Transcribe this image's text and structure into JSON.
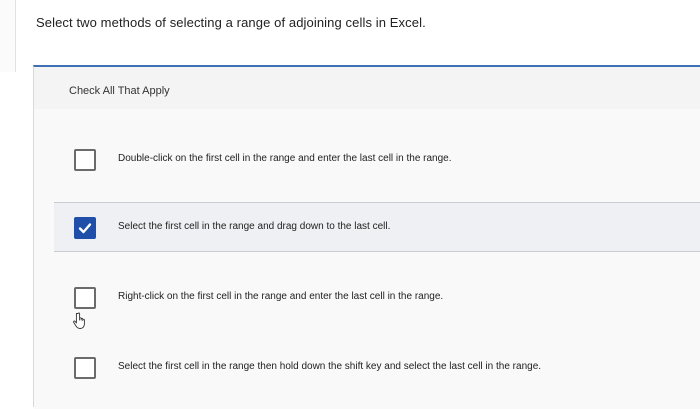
{
  "question": {
    "text": "Select two methods of selecting a range of adjoining cells in Excel."
  },
  "panel": {
    "instruction": "Check All That Apply",
    "accent_color": "#3f6fb5",
    "options": [
      {
        "label": "Double-click on the first cell in the range and enter the last cell in the range.",
        "checked": false
      },
      {
        "label": "Select the first cell in the range and drag down to the last cell.",
        "checked": true
      },
      {
        "label": "Right-click on the first cell in the range and enter the last cell in the range.",
        "checked": false
      },
      {
        "label": "Select the first cell in the range then hold down the shift key and select the last cell in the range.",
        "checked": false
      }
    ]
  },
  "cursor": {
    "icon": "hand-pointer-icon"
  },
  "colors": {
    "checkbox_checked": "#1f4fa8"
  }
}
